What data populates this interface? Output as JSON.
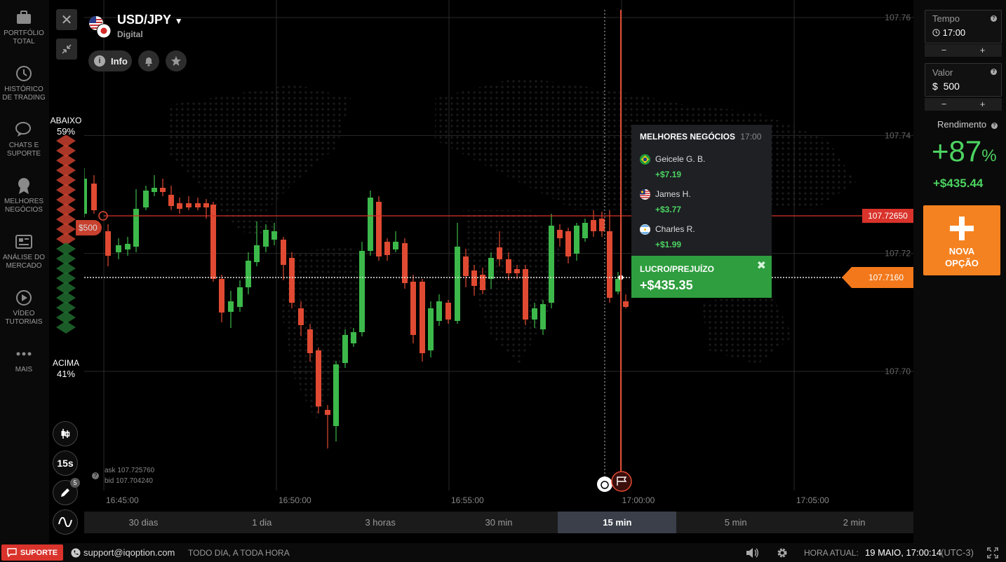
{
  "sidebar": {
    "items": [
      {
        "label": "PORTFÓLIO TOTAL",
        "icon": "briefcase-icon"
      },
      {
        "label": "HISTÓRICO DE TRADING",
        "icon": "history-icon"
      },
      {
        "label": "CHATS E SUPORTE",
        "icon": "chat-icon"
      },
      {
        "label": "MELHORES NEGÓCIOS",
        "icon": "award-icon"
      },
      {
        "label": "ANÁLISE DO MERCADO",
        "icon": "news-icon"
      },
      {
        "label": "VÍDEO TUTORIAIS",
        "icon": "play-icon"
      },
      {
        "label": "MAIS",
        "icon": "more-icon"
      }
    ]
  },
  "sentiment": {
    "down_label": "ABAIXO",
    "down_pct": "59%",
    "up_label": "ACIMA",
    "up_pct": "41%",
    "down_color": "#c8402e",
    "up_color": "#1f6b2e"
  },
  "asset": {
    "name": "USD/JPY",
    "type": "Digital",
    "info_label": "Info"
  },
  "chart": {
    "price_labels": [
      "107.76",
      "107.74",
      "107.72",
      "107.70"
    ],
    "time_labels": [
      "16:45:00",
      "16:50:00",
      "16:55:00",
      "17:00:00",
      "17:05:00"
    ],
    "strike_price": "107.72650",
    "current_price": "107.7160",
    "trade_amount": "$500",
    "ask": "ask 107.725760",
    "bid": "bid 107.704240",
    "strike_color": "#d9332b",
    "current_color": "#f2781b"
  },
  "best_trades": {
    "title": "MELHORES NEGÓCIOS",
    "time": "17:00",
    "traders": [
      {
        "name": "Geicele G. B.",
        "profit": "+$7.19",
        "flag": "brazil-flag-icon"
      },
      {
        "name": "James H.",
        "profit": "+$3.77",
        "flag": "malaysia-flag-icon"
      },
      {
        "name": "Charles R.",
        "profit": "+$1.99",
        "flag": "argentina-flag-icon"
      }
    ]
  },
  "profit_loss": {
    "title": "LUCRO/PREJUÍZO",
    "value": "+$435.35"
  },
  "right_panel": {
    "time_label": "Tempo",
    "time_value": "17:00",
    "value_label": "Valor",
    "currency": "$",
    "value_amount": "500",
    "minus": "−",
    "plus": "+",
    "yield_label": "Rendimento",
    "yield_pct": "+87",
    "yield_pct_sign": "%",
    "yield_amount": "+$435.44",
    "new_option": "NOVA OPÇÃO",
    "accent": "#f58220"
  },
  "tools": {
    "interval": "15s",
    "drawings_count": "5"
  },
  "timeframes": [
    {
      "label": "30 dias",
      "active": false
    },
    {
      "label": "1 dia",
      "active": false
    },
    {
      "label": "3 horas",
      "active": false
    },
    {
      "label": "30 min",
      "active": false
    },
    {
      "label": "15 min",
      "active": true
    },
    {
      "label": "5 min",
      "active": false
    },
    {
      "label": "2 min",
      "active": false
    }
  ],
  "footer": {
    "support_label": "SUPORTE",
    "email": "support@iqoption.com",
    "hours": "TODO DIA, A TODA HORA",
    "clock_label": "HORA ATUAL:",
    "clock_value": "19 MAIO, 17:00:14",
    "timezone": "(UTC-3)"
  }
}
